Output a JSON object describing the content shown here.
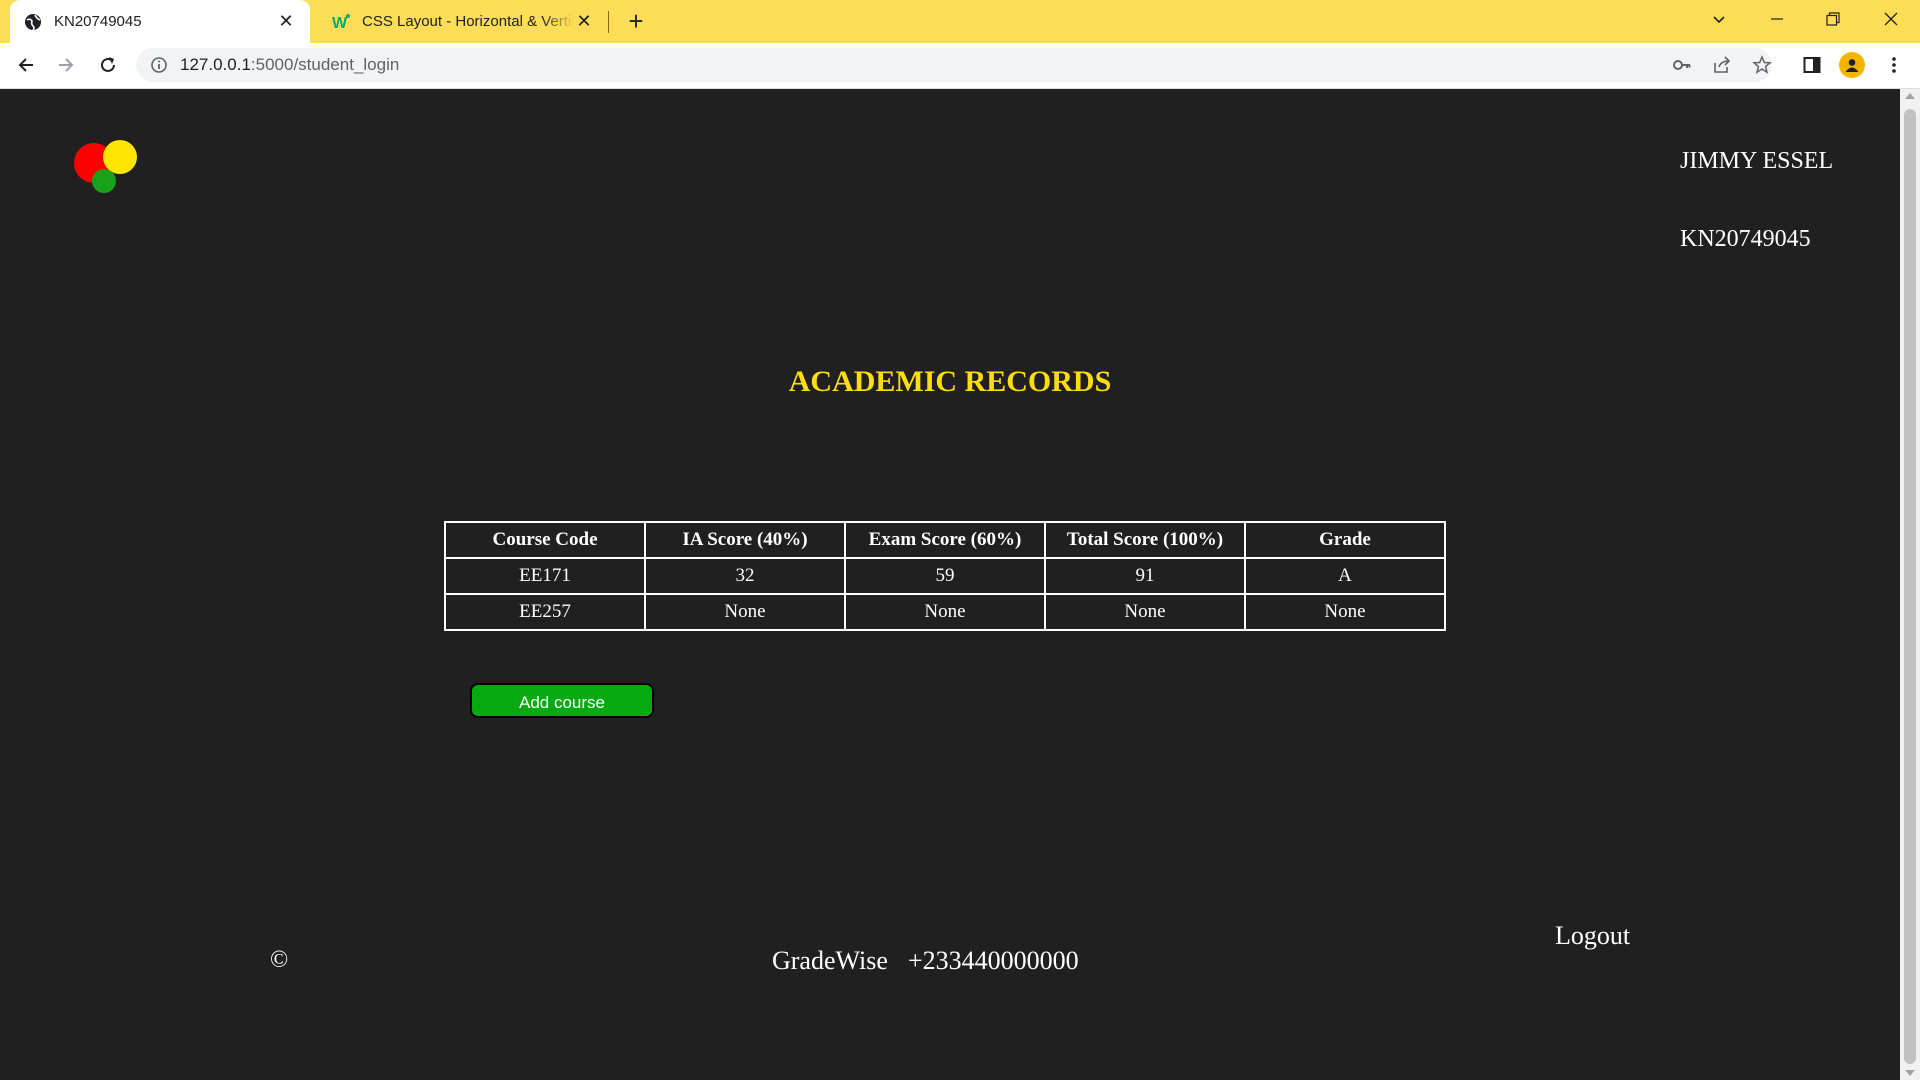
{
  "browser": {
    "tabs": [
      {
        "title": "KN20749045",
        "favicon": "globe-icon",
        "active": true
      },
      {
        "title": "CSS Layout - Horizontal & Vertical Align",
        "favicon": "w3schools-icon",
        "active": false
      }
    ],
    "url_host": "127.0.0.1",
    "url_rest": ":5000/student_login"
  },
  "header": {
    "user_name": "JIMMY ESSEL",
    "user_id": "KN20749045"
  },
  "main": {
    "heading": "ACADEMIC RECORDS",
    "table": {
      "columns": [
        "Course Code",
        "IA Score (40%)",
        "Exam Score (60%)",
        "Total Score (100%)",
        "Grade"
      ],
      "rows": [
        [
          "EE171",
          "32",
          "59",
          "91",
          "A"
        ],
        [
          "EE257",
          "None",
          "None",
          "None",
          "None"
        ]
      ]
    },
    "add_course_label": "Add course"
  },
  "footer": {
    "logout_label": "Logout",
    "copyright": "©",
    "brand": "GradeWise",
    "phone": "+233440000000"
  },
  "colors": {
    "tab_bar": "#fcdd55",
    "page_background": "#202020",
    "heading": "#fcdd0d",
    "add_button": "#04aa10",
    "logo_red": "#ff0000",
    "logo_yellow": "#ffe600",
    "logo_green": "#1aa11a"
  }
}
